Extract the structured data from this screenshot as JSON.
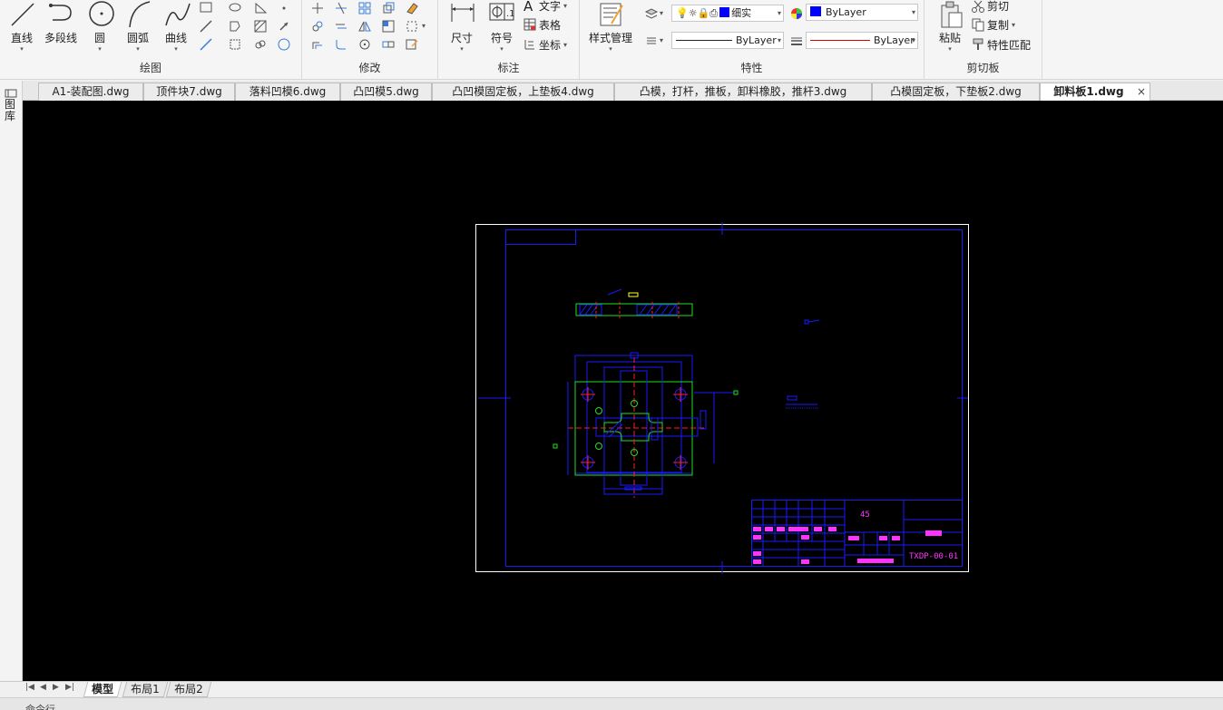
{
  "ribbon": {
    "draw": {
      "title": "绘图",
      "line": "直线",
      "polyline": "多段线",
      "circle": "圆",
      "arc": "圆弧",
      "curve": "曲线"
    },
    "modify": {
      "title": "修改"
    },
    "annotate": {
      "title": "标注",
      "dimension": "尺寸",
      "symbol": "符号",
      "text": "文字",
      "table": "表格",
      "coordinate": "坐标"
    },
    "properties": {
      "title": "特性",
      "style_manager": "样式管理",
      "layer_name": "细实",
      "color_value": "ByLayer",
      "linetype_value": "ByLayer",
      "lineweight_value": "ByLayer"
    },
    "clipboard": {
      "title": "剪切板",
      "paste": "粘贴",
      "cut": "剪切",
      "copy": "复制",
      "match_properties": "特性匹配"
    }
  },
  "tabs": [
    {
      "label": "A1-装配图.dwg"
    },
    {
      "label": "顶件块7.dwg"
    },
    {
      "label": "落料凹模6.dwg"
    },
    {
      "label": "凸凹模5.dwg"
    },
    {
      "label": "凸凹模固定板，上垫板4.dwg"
    },
    {
      "label": "凸模，打杆，推板，卸料橡胶，推杆3.dwg"
    },
    {
      "label": "凸模固定板，下垫板2.dwg"
    },
    {
      "label": "卸料板1.dwg",
      "active": true
    }
  ],
  "tab_close_glyph": "×",
  "left_strip_label": "图库",
  "drawing": {
    "material": "45",
    "part_name": "卸料板",
    "drawing_number": "TXDP-00-01"
  },
  "layout_tabs": [
    {
      "label": "模型",
      "active": true
    },
    {
      "label": "布局1"
    },
    {
      "label": "布局2"
    }
  ],
  "command_line": "命令行",
  "colors": {
    "canvas_bg": "#000000",
    "frame": "#ffffff",
    "blue_line": "#1a1aff",
    "green_line": "#22dd22",
    "red_center": "#ff2020",
    "magenta_text": "#ff33ff",
    "layer_blue": "#0000ff"
  }
}
